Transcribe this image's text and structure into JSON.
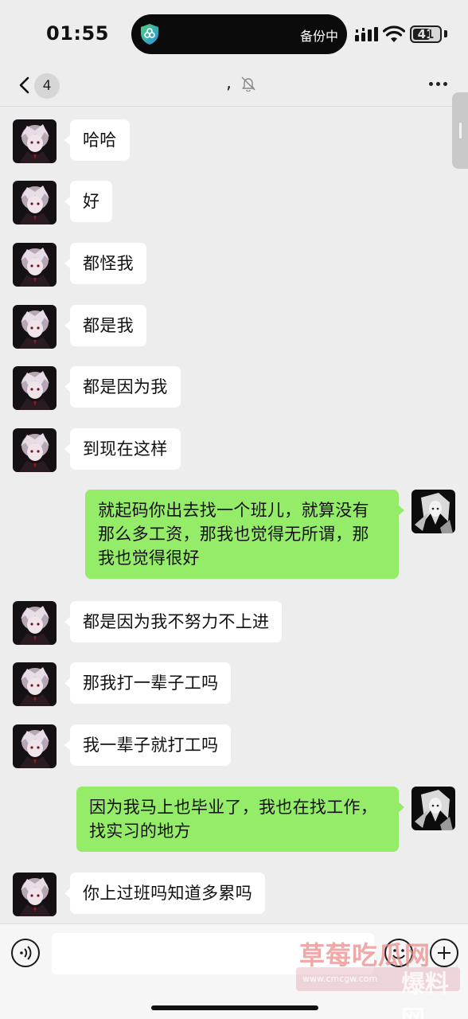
{
  "status_bar": {
    "time": "01:55",
    "island_text": "备份中",
    "battery": "41"
  },
  "header": {
    "unread_count": "4",
    "title": ","
  },
  "messages": [
    {
      "side": "left",
      "text": "哈哈"
    },
    {
      "side": "left",
      "text": "好"
    },
    {
      "side": "left",
      "text": "都怪我"
    },
    {
      "side": "left",
      "text": "都是我"
    },
    {
      "side": "left",
      "text": "都是因为我"
    },
    {
      "side": "left",
      "text": "到现在这样"
    },
    {
      "side": "right",
      "lines": [
        "就起码你出去找一个班儿，就算没有",
        "那么多工资，那我也觉得无所谓，那",
        "我也觉得很好"
      ]
    },
    {
      "side": "left",
      "text": "都是因为我不努力不上进"
    },
    {
      "side": "left",
      "text": "那我打一辈子工吗"
    },
    {
      "side": "left",
      "text": "我一辈子就打工吗"
    },
    {
      "side": "right",
      "lines": [
        "因为我马上也毕业了，我也在找工作，",
        "找实习的地方"
      ]
    },
    {
      "side": "left",
      "text": "你上过班吗知道多累吗"
    }
  ],
  "input": {
    "value": "",
    "placeholder": ""
  },
  "watermark": {
    "line1": "草莓吃瓜网",
    "line2": "www.cmcgw.com",
    "line3": "爆料网"
  },
  "colors": {
    "background": "#ededed",
    "bubble_self": "#95ec69",
    "bubble_other": "#ffffff"
  }
}
